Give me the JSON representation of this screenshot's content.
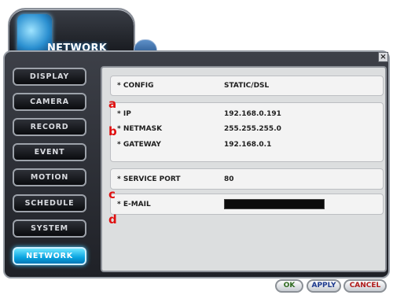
{
  "header": {
    "title": "NETWORK"
  },
  "window": {
    "close_label": "×"
  },
  "sidebar": {
    "items": [
      {
        "label": "DISPLAY",
        "active": false
      },
      {
        "label": "CAMERA",
        "active": false
      },
      {
        "label": "RECORD",
        "active": false
      },
      {
        "label": "EVENT",
        "active": false
      },
      {
        "label": "MOTION",
        "active": false
      },
      {
        "label": "SCHEDULE",
        "active": false
      },
      {
        "label": "SYSTEM",
        "active": false
      },
      {
        "label": "NETWORK",
        "active": true
      }
    ]
  },
  "settings": {
    "config": {
      "label": "* CONFIG",
      "value": "STATIC/DSL"
    },
    "ip": {
      "label": "* IP",
      "value": "192.168.0.191"
    },
    "netmask": {
      "label": "* NETMASK",
      "value": "255.255.255.0"
    },
    "gateway": {
      "label": "* GATEWAY",
      "value": "192.168.0.1"
    },
    "service_port": {
      "label": "* SERVICE PORT",
      "value": "80"
    },
    "email": {
      "label": "* E-MAIL",
      "value": ""
    }
  },
  "annotations": [
    "a",
    "b",
    "c",
    "d"
  ],
  "footer": {
    "ok_label": "OK",
    "apply_label": "APPLY",
    "cancel_label": "CANCEL"
  },
  "colors": {
    "active_tab": "#0aa4e0",
    "marker": "#e01010",
    "ok": "#2e6b1f",
    "apply": "#1d3a8f",
    "cancel": "#b01a1a"
  }
}
